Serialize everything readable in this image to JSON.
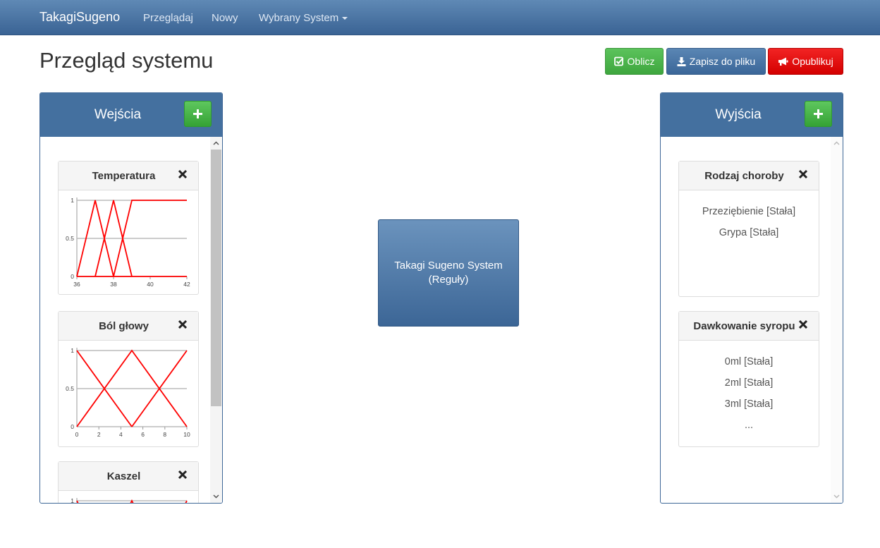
{
  "navbar": {
    "brand": "TakagiSugeno",
    "items": [
      "Przeglądaj",
      "Nowy",
      "Wybrany System"
    ]
  },
  "page": {
    "title": "Przegląd systemu"
  },
  "toolbar": {
    "calc_label": "Oblicz",
    "save_label": "Zapisz do pliku",
    "publish_label": "Opublikuj"
  },
  "inputs_panel": {
    "title": "Wejścia",
    "cards": [
      {
        "title": "Temperatura",
        "y_ticks": [
          "1",
          "0.5",
          "0"
        ],
        "x_ticks": [
          "36",
          "38",
          "40",
          "42"
        ]
      },
      {
        "title": "Ból głowy",
        "y_ticks": [
          "1",
          "0.5",
          "0"
        ],
        "x_ticks": [
          "0",
          "2",
          "4",
          "6",
          "8",
          "10"
        ]
      },
      {
        "title": "Kaszel",
        "y_ticks": [
          "1"
        ]
      }
    ]
  },
  "outputs_panel": {
    "title": "Wyjścia",
    "cards": [
      {
        "title": "Rodzaj choroby",
        "lines": [
          "Przeziębienie [Stała]",
          "Grypa [Stała]"
        ]
      },
      {
        "title": "Dawkowanie syropu",
        "lines": [
          "0ml [Stała]",
          "2ml [Stała]",
          "3ml [Stała]",
          "..."
        ]
      }
    ]
  },
  "system": {
    "line1": "Takagi Sugeno System",
    "line2": "(Reguły)"
  },
  "colors": {
    "navbar": "#44709f",
    "accent_green": "#3ea63e",
    "accent_red": "#d40000",
    "membership_line": "#ff0000"
  }
}
